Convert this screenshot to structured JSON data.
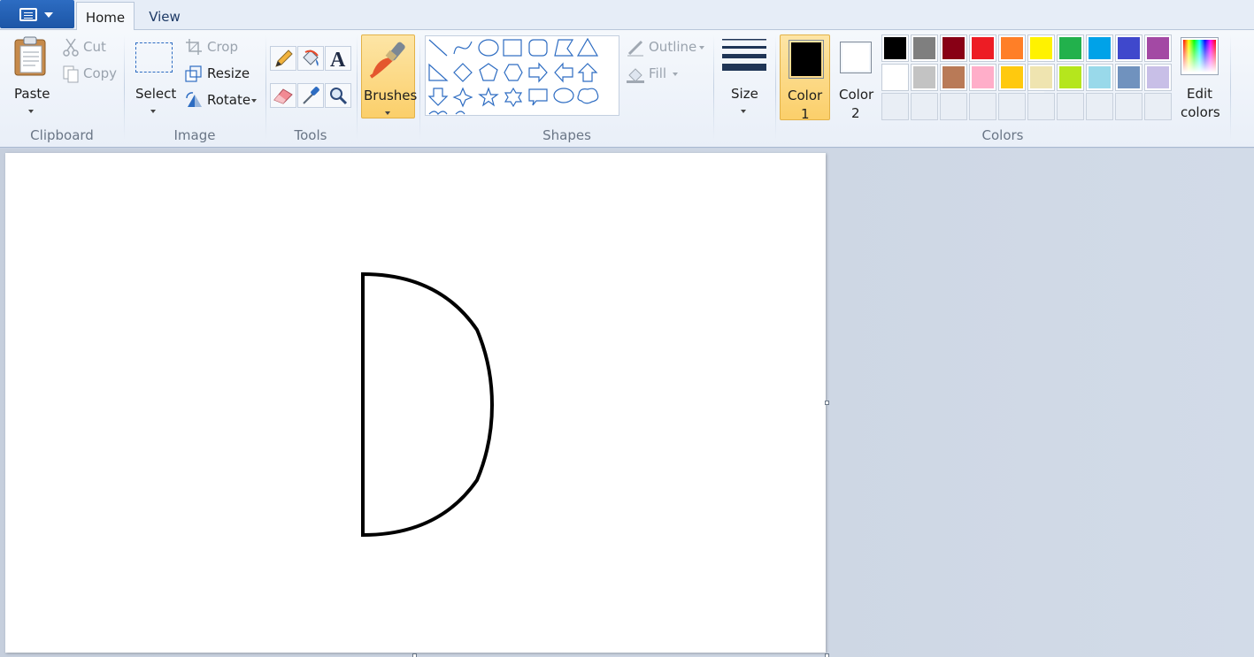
{
  "tabs": {
    "home": "Home",
    "view": "View"
  },
  "clipboard": {
    "paste": "Paste",
    "cut": "Cut",
    "copy": "Copy",
    "group": "Clipboard"
  },
  "image": {
    "select": "Select",
    "crop": "Crop",
    "resize": "Resize",
    "rotate": "Rotate",
    "group": "Image"
  },
  "tools": {
    "group": "Tools"
  },
  "brushes": {
    "label": "Brushes"
  },
  "shapes": {
    "group": "Shapes",
    "outline": "Outline",
    "fill": "Fill"
  },
  "size": {
    "label": "Size"
  },
  "colors": {
    "color1_line1": "Color",
    "color1_line2": "1",
    "color2_line1": "Color",
    "color2_line2": "2",
    "edit_line1": "Edit",
    "edit_line2": "colors",
    "group": "Colors",
    "color1_value": "#000000",
    "color2_value": "#ffffff",
    "row1": [
      "#000000",
      "#7f7f7f",
      "#880015",
      "#ed1c24",
      "#ff7f27",
      "#fff200",
      "#22b14c",
      "#00a2e8",
      "#3f48cc",
      "#a349a4"
    ],
    "row2": [
      "#ffffff",
      "#c3c3c3",
      "#b97a57",
      "#ffaec9",
      "#ffc90e",
      "#efe4b0",
      "#b5e61d",
      "#99d9ea",
      "#7092be",
      "#c8bfe7"
    ]
  }
}
